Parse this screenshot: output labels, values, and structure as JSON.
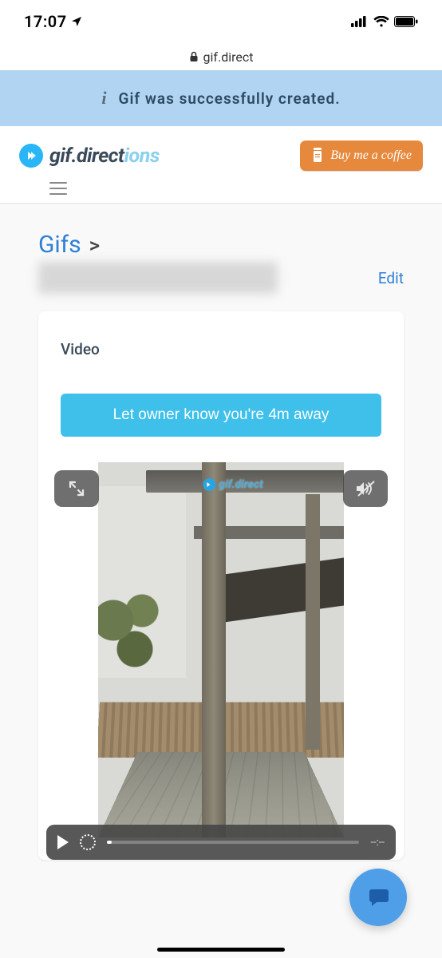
{
  "status": {
    "time": "17:07"
  },
  "url": {
    "host": "gif.direct"
  },
  "banner": {
    "message": "Gif was successfully created."
  },
  "brand": {
    "dark": "gif.direct",
    "light": "ions"
  },
  "coffee": {
    "label": "Buy me a coffee"
  },
  "breadcrumb": {
    "root": "Gifs",
    "sep": ">"
  },
  "actions": {
    "edit": "Edit"
  },
  "card": {
    "label": "Video"
  },
  "cta": {
    "label": "Let owner know you're 4m away"
  },
  "player": {
    "time": "--:--"
  },
  "watermark": {
    "text": "gif.direct"
  }
}
